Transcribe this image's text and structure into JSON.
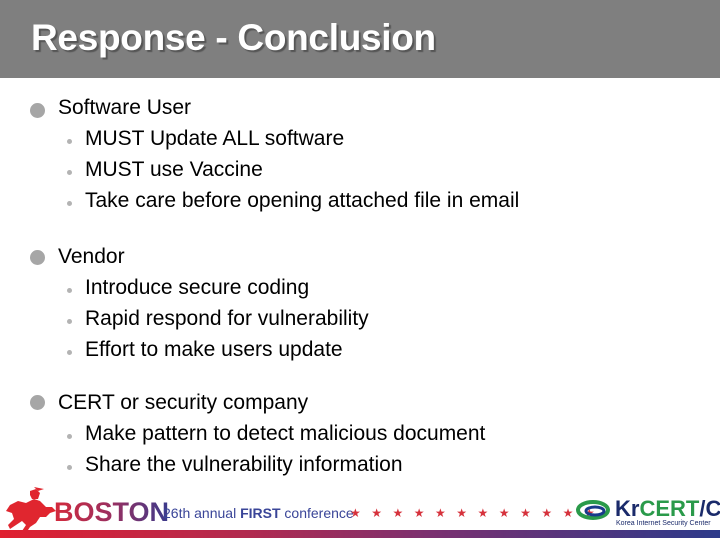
{
  "slide": {
    "title": "Response - Conclusion",
    "sections": [
      {
        "heading": "Software User",
        "items": [
          "MUST Update ALL software",
          "MUST use Vaccine",
          "Take care before opening attached file in email"
        ]
      },
      {
        "heading": "Vendor",
        "items": [
          "Introduce secure coding",
          "Rapid respond for vulnerability",
          "Effort to make users update"
        ]
      },
      {
        "heading": "CERT or security company",
        "items": [
          "Make pattern to detect malicious document",
          "Share the vulnerability information"
        ]
      }
    ]
  },
  "footer": {
    "city": "BOSTON",
    "conf_prefix": "26th annual ",
    "conf_bold": "FIRST",
    "conf_suffix": " conference",
    "stars": "★★★★★★★★★★★★",
    "star_count": 12,
    "org_kr": "Kr",
    "org_cert": "CERT",
    "org_cc": "/CC",
    "org_subtitle": "Korea Internet Security Center",
    "colors": {
      "header_bg": "#7f7f7f",
      "star": "#d6323c",
      "conf_text": "#3a4598",
      "cert_green": "#2a9a4a"
    }
  }
}
